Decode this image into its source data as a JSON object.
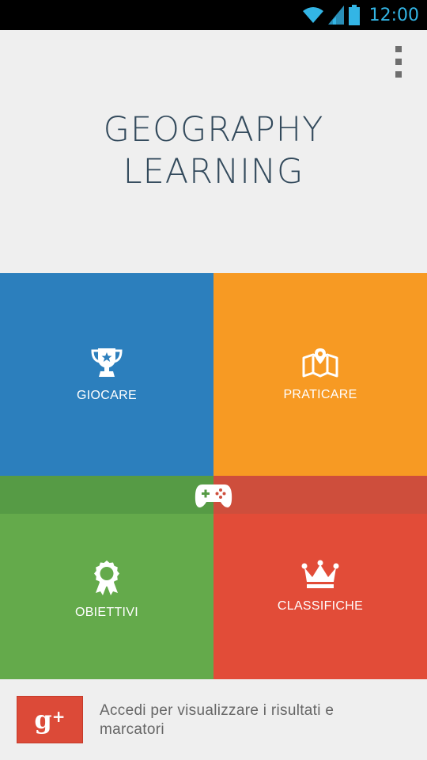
{
  "status_bar": {
    "time": "12:00",
    "icons": [
      "wifi-icon",
      "cell-signal-icon",
      "battery-icon"
    ],
    "accent_color": "#33b5e5"
  },
  "header": {
    "title_line1": "GEOGRAPHY",
    "title_line2": "LEARNING",
    "menu_icon": "overflow-menu-icon"
  },
  "tiles": [
    {
      "label": "GIOCARE",
      "icon": "trophy-icon",
      "color": "#2c7fbd"
    },
    {
      "label": "PRATICARE",
      "icon": "map-pin-icon",
      "color": "#f79a23"
    },
    {
      "label": "OBIETTIVI",
      "icon": "award-ribbon-icon",
      "color": "#64aa4b"
    },
    {
      "label": "CLASSIFICHE",
      "icon": "crown-icon",
      "color": "#e24c38"
    }
  ],
  "center_icon": "game-controller-icon",
  "signin": {
    "button_label": "g",
    "button_plus": "+",
    "button_color": "#dc4a38",
    "text": "Accedi per visualizzare i risultati e marcatori"
  }
}
